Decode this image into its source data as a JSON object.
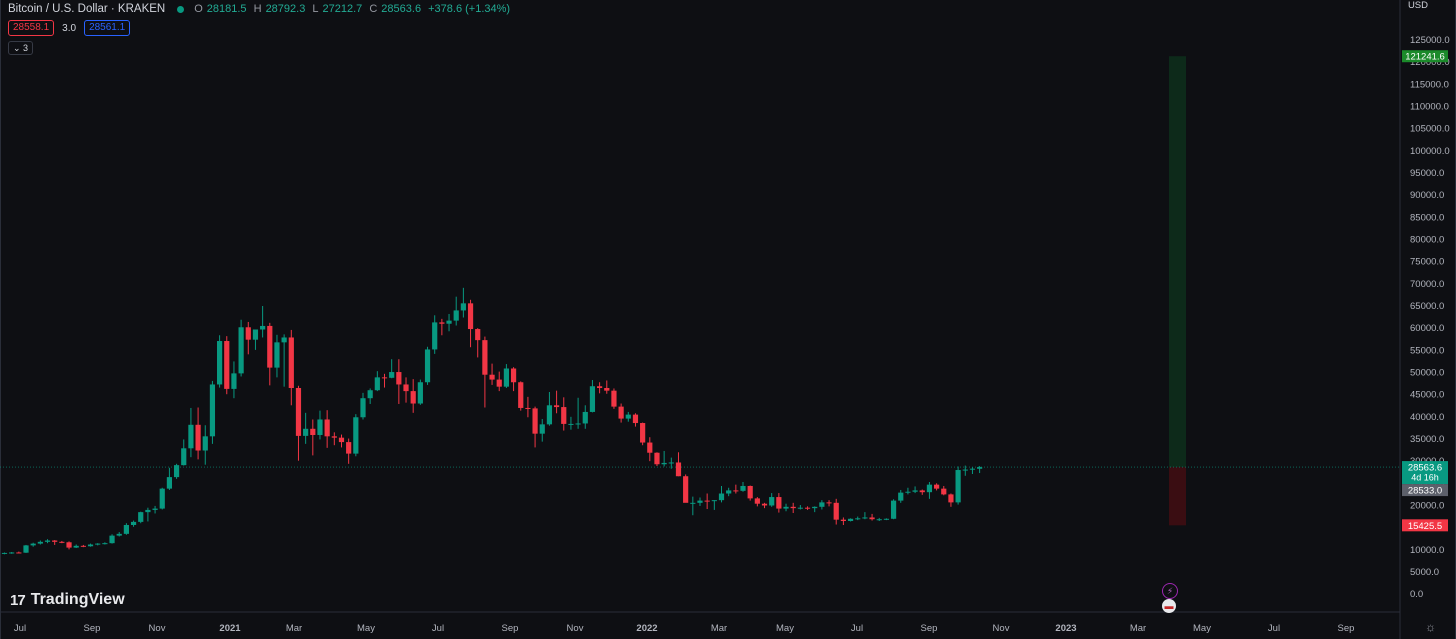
{
  "header": {
    "symbol": "Bitcoin / U.S. Dollar · KRAKEN",
    "o_key": "O",
    "o_val": "28181.5",
    "h_key": "H",
    "h_val": "28792.3",
    "l_key": "L",
    "l_val": "27212.7",
    "c_key": "C",
    "c_val": "28563.6",
    "change": "+378.6 (+1.34%)"
  },
  "trade": {
    "sell_price": "28558.1",
    "spread": "3.0",
    "buy_price": "28561.1"
  },
  "indicators": {
    "collapse_label": "⌄ 3"
  },
  "axis": {
    "currency": "USD"
  },
  "branding": {
    "logo_mark": "17",
    "logo_text": "TradingView"
  },
  "events": {
    "flash_icon": "flash-icon",
    "us_flag_icon": "us-flag-icon"
  },
  "colors": {
    "up": "#089981",
    "down": "#f23645",
    "background": "#0e0f13",
    "target_zone": "#0d2a1a",
    "stop_zone": "#3a0d12"
  },
  "chart_data": {
    "type": "candlestick",
    "interval": "weekly",
    "y_scale": "linear",
    "ylim": [
      0,
      127000
    ],
    "y_ticks": [
      "0.0",
      "5000.0",
      "10000.0",
      "15000.0",
      "20000.0",
      "25000.0",
      "30000.0",
      "35000.0",
      "40000.0",
      "45000.0",
      "50000.0",
      "55000.0",
      "60000.0",
      "65000.0",
      "70000.0",
      "75000.0",
      "80000.0",
      "85000.0",
      "90000.0",
      "95000.0",
      "100000.0",
      "105000.0",
      "110000.0",
      "115000.0",
      "120000.0",
      "125000.0"
    ],
    "x_ticks": [
      "Jul",
      "Sep",
      "Nov",
      "2021",
      "Mar",
      "May",
      "Jul",
      "Sep",
      "Nov",
      "2022",
      "Mar",
      "May",
      "Jul",
      "Sep",
      "Nov",
      "2023",
      "Mar",
      "May",
      "Jul",
      "Sep"
    ],
    "candles": [
      [
        9100,
        9300,
        8900,
        9200
      ],
      [
        9200,
        9400,
        9000,
        9300
      ],
      [
        9300,
        9500,
        9100,
        9250
      ],
      [
        9250,
        11000,
        9200,
        10900
      ],
      [
        10900,
        11500,
        10600,
        11300
      ],
      [
        11300,
        12000,
        11100,
        11700
      ],
      [
        11700,
        12300,
        11400,
        12000
      ],
      [
        12000,
        12100,
        11000,
        11700
      ],
      [
        11700,
        11900,
        11400,
        11600
      ],
      [
        11600,
        11800,
        10000,
        10400
      ],
      [
        10400,
        11100,
        10300,
        10800
      ],
      [
        10800,
        11000,
        10500,
        10700
      ],
      [
        10700,
        11300,
        10600,
        11100
      ],
      [
        11100,
        11400,
        10900,
        11300
      ],
      [
        11300,
        11600,
        11100,
        11400
      ],
      [
        11400,
        13400,
        11300,
        13100
      ],
      [
        13100,
        13900,
        12900,
        13500
      ],
      [
        13500,
        15900,
        13300,
        15500
      ],
      [
        15500,
        16500,
        15100,
        16200
      ],
      [
        16200,
        18500,
        15900,
        18400
      ],
      [
        18400,
        19400,
        16300,
        18900
      ],
      [
        18900,
        19800,
        18100,
        19200
      ],
      [
        19200,
        23900,
        19000,
        23700
      ],
      [
        23700,
        28400,
        23400,
        26300
      ],
      [
        26300,
        29300,
        25900,
        29000
      ],
      [
        29000,
        34800,
        28900,
        32800
      ],
      [
        32800,
        41900,
        30800,
        38100
      ],
      [
        38100,
        42000,
        30300,
        32300
      ],
      [
        32300,
        38000,
        29100,
        35500
      ],
      [
        35500,
        48000,
        33800,
        47200
      ],
      [
        47200,
        58300,
        46500,
        57000
      ],
      [
        57000,
        58100,
        45000,
        46200
      ],
      [
        46200,
        52400,
        44100,
        49700
      ],
      [
        49700,
        61800,
        49000,
        60100
      ],
      [
        60100,
        61300,
        54000,
        57300
      ],
      [
        57300,
        58900,
        55000,
        59600
      ],
      [
        59600,
        64900,
        57800,
        60400
      ],
      [
        60400,
        61100,
        47000,
        51000
      ],
      [
        51000,
        58400,
        48800,
        56700
      ],
      [
        56700,
        58500,
        46700,
        57800
      ],
      [
        57800,
        59500,
        42500,
        46400
      ],
      [
        46400,
        46900,
        30000,
        35600
      ],
      [
        35600,
        40800,
        33800,
        37200
      ],
      [
        37200,
        39300,
        31200,
        35800
      ],
      [
        35800,
        41300,
        34800,
        39300
      ],
      [
        39300,
        41400,
        32900,
        35500
      ],
      [
        35500,
        36400,
        33500,
        35200
      ],
      [
        35200,
        35900,
        33000,
        34200
      ],
      [
        34200,
        35000,
        29300,
        31600
      ],
      [
        31600,
        40500,
        31000,
        39800
      ],
      [
        39800,
        45300,
        39300,
        44100
      ],
      [
        44100,
        46300,
        42800,
        45900
      ],
      [
        45900,
        50200,
        45700,
        48800
      ],
      [
        48800,
        49600,
        46500,
        48700
      ],
      [
        48700,
        52900,
        48600,
        50000
      ],
      [
        50000,
        52900,
        42800,
        47200
      ],
      [
        47200,
        48800,
        43100,
        45700
      ],
      [
        45700,
        48400,
        40800,
        42900
      ],
      [
        42900,
        48300,
        42600,
        47700
      ],
      [
        47700,
        55700,
        47100,
        55100
      ],
      [
        55100,
        62800,
        54100,
        61200
      ],
      [
        61200,
        62000,
        58300,
        60900
      ],
      [
        60900,
        63100,
        59200,
        61600
      ],
      [
        61600,
        67000,
        60500,
        63900
      ],
      [
        63900,
        69000,
        62300,
        65500
      ],
      [
        65500,
        66300,
        55600,
        59700
      ],
      [
        59700,
        59900,
        53300,
        57200
      ],
      [
        57200,
        58000,
        42000,
        49400
      ],
      [
        49400,
        51900,
        47100,
        48300
      ],
      [
        48300,
        50100,
        45700,
        46700
      ],
      [
        46700,
        51800,
        46400,
        50800
      ],
      [
        50800,
        51100,
        45700,
        47700
      ],
      [
        47700,
        47900,
        41300,
        41900
      ],
      [
        41900,
        44400,
        39800,
        41800
      ],
      [
        41800,
        42200,
        33000,
        36100
      ],
      [
        36100,
        39400,
        34300,
        38200
      ],
      [
        38200,
        45500,
        37900,
        42500
      ],
      [
        42500,
        45800,
        40700,
        42100
      ],
      [
        42100,
        44300,
        36800,
        38300
      ],
      [
        38300,
        39900,
        37000,
        38300
      ],
      [
        38300,
        44200,
        37200,
        38400
      ],
      [
        38400,
        42500,
        37200,
        41000
      ],
      [
        41000,
        48200,
        40900,
        46800
      ],
      [
        46800,
        47700,
        45200,
        46400
      ],
      [
        46400,
        48100,
        45100,
        45800
      ],
      [
        45800,
        46300,
        41700,
        42200
      ],
      [
        42200,
        42900,
        38600,
        39500
      ],
      [
        39500,
        41000,
        38800,
        40400
      ],
      [
        40400,
        40700,
        37700,
        38500
      ],
      [
        38500,
        38600,
        33500,
        34100
      ],
      [
        34100,
        35300,
        29900,
        31800
      ],
      [
        31800,
        31900,
        28800,
        29200
      ],
      [
        29200,
        32200,
        28700,
        29500
      ],
      [
        29500,
        30700,
        28200,
        29600
      ],
      [
        29600,
        31900,
        26500,
        26500
      ],
      [
        26500,
        26900,
        20900,
        20500
      ],
      [
        20500,
        21900,
        17700,
        20500
      ],
      [
        20500,
        21700,
        19800,
        21000
      ],
      [
        21000,
        22600,
        19100,
        20900
      ],
      [
        20900,
        21100,
        18900,
        21100
      ],
      [
        21100,
        24300,
        20600,
        22600
      ],
      [
        22600,
        23900,
        22000,
        23300
      ],
      [
        23300,
        24600,
        22600,
        23200
      ],
      [
        23200,
        25200,
        23000,
        24300
      ],
      [
        24300,
        24400,
        21000,
        21500
      ],
      [
        21500,
        21800,
        19700,
        20300
      ],
      [
        20300,
        20500,
        19300,
        19900
      ],
      [
        19900,
        22700,
        19600,
        21800
      ],
      [
        21800,
        22700,
        18300,
        19200
      ],
      [
        19200,
        20300,
        18600,
        19600
      ],
      [
        19600,
        20500,
        18200,
        19300
      ],
      [
        19300,
        20000,
        19000,
        19400
      ],
      [
        19400,
        19700,
        18900,
        19300
      ],
      [
        19300,
        19700,
        18400,
        19600
      ],
      [
        19600,
        21100,
        19000,
        20600
      ],
      [
        20600,
        21100,
        19700,
        20500
      ],
      [
        20500,
        21400,
        15600,
        16700
      ],
      [
        16700,
        17200,
        15500,
        16400
      ],
      [
        16400,
        17000,
        16300,
        16900
      ],
      [
        16900,
        17400,
        16600,
        17000
      ],
      [
        17000,
        18400,
        16800,
        17200
      ],
      [
        17200,
        18000,
        16500,
        16800
      ],
      [
        16800,
        17100,
        16400,
        16800
      ],
      [
        16800,
        17000,
        16600,
        16900
      ],
      [
        16900,
        21300,
        16800,
        21000
      ],
      [
        21000,
        23400,
        20500,
        22800
      ],
      [
        22800,
        23900,
        22400,
        23000
      ],
      [
        23000,
        24200,
        22700,
        23300
      ],
      [
        23300,
        23500,
        22300,
        22900
      ],
      [
        22900,
        25200,
        21400,
        24600
      ],
      [
        24600,
        24900,
        23300,
        23700
      ],
      [
        23700,
        24300,
        22200,
        22400
      ],
      [
        22400,
        22600,
        19600,
        20600
      ],
      [
        20600,
        28700,
        20100,
        27900
      ],
      [
        27900,
        28900,
        26600,
        28000
      ],
      [
        28000,
        28500,
        27000,
        28200
      ],
      [
        28181.5,
        28792.3,
        27212.7,
        28563.6
      ]
    ],
    "last_price": "28563.6",
    "countdown": "4d 16h",
    "prev_close_label": "28533.0",
    "position": {
      "entry": 28563.6,
      "target": 121241.6,
      "stop": 15425.5,
      "target_label": "121241.6",
      "stop_label": "15425.5"
    }
  }
}
